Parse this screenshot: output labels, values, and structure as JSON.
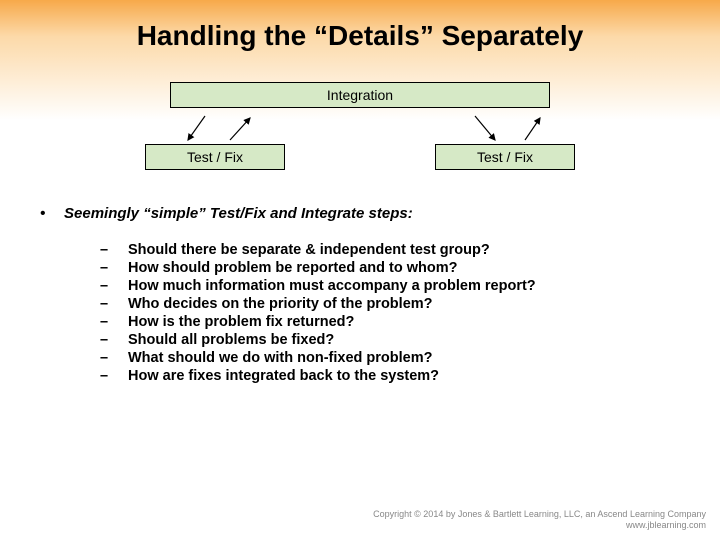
{
  "title": "Handling the “Details” Separately",
  "diagram": {
    "integration": "Integration",
    "testfix_left": "Test / Fix",
    "testfix_right": "Test / Fix"
  },
  "main_bullet": "Seemingly “simple” Test/Fix and Integrate steps:",
  "subs": [
    "Should there be separate & independent test group?",
    "How should problem be reported and to whom?",
    "How much information must accompany a problem report?",
    "Who decides on the priority of the problem?",
    "How is the problem fix returned?",
    "Should all problems be fixed?",
    "What should we do with non-fixed problem?",
    "How are fixes integrated back to the system?"
  ],
  "footer": {
    "copyright": "Copyright © 2014 by Jones & Bartlett Learning, LLC, an Ascend Learning Company",
    "url": "www.jblearning.com"
  }
}
